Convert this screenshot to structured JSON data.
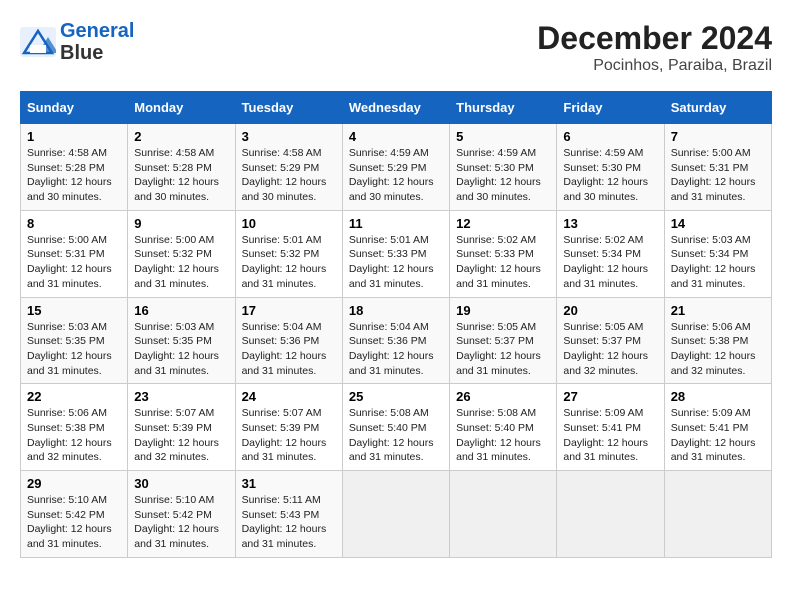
{
  "logo": {
    "line1": "General",
    "line2": "Blue"
  },
  "title": "December 2024",
  "subtitle": "Pocinhos, Paraiba, Brazil",
  "days_of_week": [
    "Sunday",
    "Monday",
    "Tuesday",
    "Wednesday",
    "Thursday",
    "Friday",
    "Saturday"
  ],
  "weeks": [
    [
      {
        "day": 1,
        "info": "Sunrise: 4:58 AM\nSunset: 5:28 PM\nDaylight: 12 hours\nand 30 minutes."
      },
      {
        "day": 2,
        "info": "Sunrise: 4:58 AM\nSunset: 5:28 PM\nDaylight: 12 hours\nand 30 minutes."
      },
      {
        "day": 3,
        "info": "Sunrise: 4:58 AM\nSunset: 5:29 PM\nDaylight: 12 hours\nand 30 minutes."
      },
      {
        "day": 4,
        "info": "Sunrise: 4:59 AM\nSunset: 5:29 PM\nDaylight: 12 hours\nand 30 minutes."
      },
      {
        "day": 5,
        "info": "Sunrise: 4:59 AM\nSunset: 5:30 PM\nDaylight: 12 hours\nand 30 minutes."
      },
      {
        "day": 6,
        "info": "Sunrise: 4:59 AM\nSunset: 5:30 PM\nDaylight: 12 hours\nand 30 minutes."
      },
      {
        "day": 7,
        "info": "Sunrise: 5:00 AM\nSunset: 5:31 PM\nDaylight: 12 hours\nand 31 minutes."
      }
    ],
    [
      {
        "day": 8,
        "info": "Sunrise: 5:00 AM\nSunset: 5:31 PM\nDaylight: 12 hours\nand 31 minutes."
      },
      {
        "day": 9,
        "info": "Sunrise: 5:00 AM\nSunset: 5:32 PM\nDaylight: 12 hours\nand 31 minutes."
      },
      {
        "day": 10,
        "info": "Sunrise: 5:01 AM\nSunset: 5:32 PM\nDaylight: 12 hours\nand 31 minutes."
      },
      {
        "day": 11,
        "info": "Sunrise: 5:01 AM\nSunset: 5:33 PM\nDaylight: 12 hours\nand 31 minutes."
      },
      {
        "day": 12,
        "info": "Sunrise: 5:02 AM\nSunset: 5:33 PM\nDaylight: 12 hours\nand 31 minutes."
      },
      {
        "day": 13,
        "info": "Sunrise: 5:02 AM\nSunset: 5:34 PM\nDaylight: 12 hours\nand 31 minutes."
      },
      {
        "day": 14,
        "info": "Sunrise: 5:03 AM\nSunset: 5:34 PM\nDaylight: 12 hours\nand 31 minutes."
      }
    ],
    [
      {
        "day": 15,
        "info": "Sunrise: 5:03 AM\nSunset: 5:35 PM\nDaylight: 12 hours\nand 31 minutes."
      },
      {
        "day": 16,
        "info": "Sunrise: 5:03 AM\nSunset: 5:35 PM\nDaylight: 12 hours\nand 31 minutes."
      },
      {
        "day": 17,
        "info": "Sunrise: 5:04 AM\nSunset: 5:36 PM\nDaylight: 12 hours\nand 31 minutes."
      },
      {
        "day": 18,
        "info": "Sunrise: 5:04 AM\nSunset: 5:36 PM\nDaylight: 12 hours\nand 31 minutes."
      },
      {
        "day": 19,
        "info": "Sunrise: 5:05 AM\nSunset: 5:37 PM\nDaylight: 12 hours\nand 31 minutes."
      },
      {
        "day": 20,
        "info": "Sunrise: 5:05 AM\nSunset: 5:37 PM\nDaylight: 12 hours\nand 32 minutes."
      },
      {
        "day": 21,
        "info": "Sunrise: 5:06 AM\nSunset: 5:38 PM\nDaylight: 12 hours\nand 32 minutes."
      }
    ],
    [
      {
        "day": 22,
        "info": "Sunrise: 5:06 AM\nSunset: 5:38 PM\nDaylight: 12 hours\nand 32 minutes."
      },
      {
        "day": 23,
        "info": "Sunrise: 5:07 AM\nSunset: 5:39 PM\nDaylight: 12 hours\nand 32 minutes."
      },
      {
        "day": 24,
        "info": "Sunrise: 5:07 AM\nSunset: 5:39 PM\nDaylight: 12 hours\nand 31 minutes."
      },
      {
        "day": 25,
        "info": "Sunrise: 5:08 AM\nSunset: 5:40 PM\nDaylight: 12 hours\nand 31 minutes."
      },
      {
        "day": 26,
        "info": "Sunrise: 5:08 AM\nSunset: 5:40 PM\nDaylight: 12 hours\nand 31 minutes."
      },
      {
        "day": 27,
        "info": "Sunrise: 5:09 AM\nSunset: 5:41 PM\nDaylight: 12 hours\nand 31 minutes."
      },
      {
        "day": 28,
        "info": "Sunrise: 5:09 AM\nSunset: 5:41 PM\nDaylight: 12 hours\nand 31 minutes."
      }
    ],
    [
      {
        "day": 29,
        "info": "Sunrise: 5:10 AM\nSunset: 5:42 PM\nDaylight: 12 hours\nand 31 minutes."
      },
      {
        "day": 30,
        "info": "Sunrise: 5:10 AM\nSunset: 5:42 PM\nDaylight: 12 hours\nand 31 minutes."
      },
      {
        "day": 31,
        "info": "Sunrise: 5:11 AM\nSunset: 5:43 PM\nDaylight: 12 hours\nand 31 minutes."
      },
      null,
      null,
      null,
      null
    ]
  ]
}
